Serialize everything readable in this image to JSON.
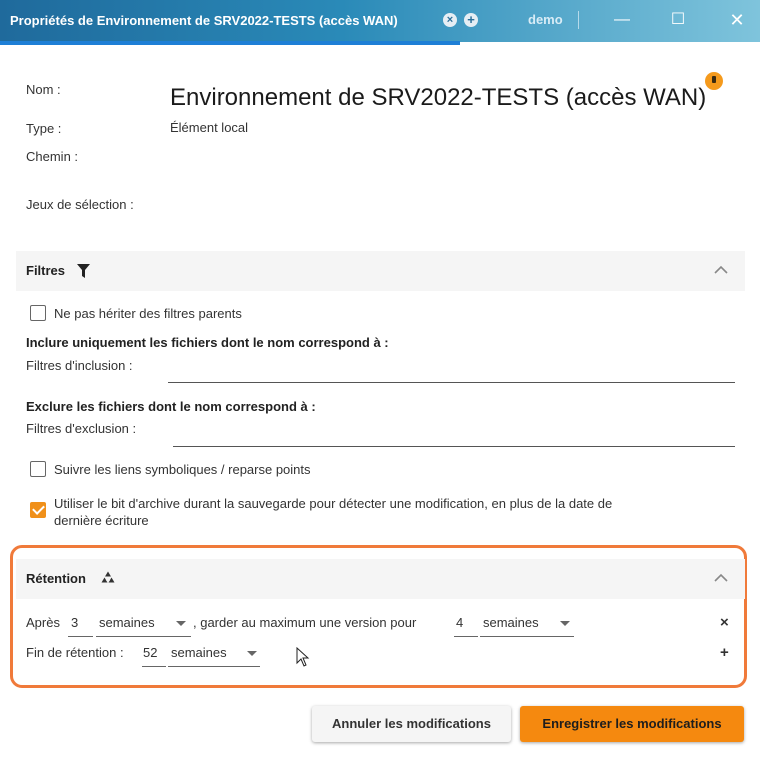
{
  "window": {
    "title": "Propriétés de Environnement de SRV2022-TESTS (accès WAN)",
    "user": "demo",
    "tab_close_glyph": "×",
    "tab_add_glyph": "+",
    "min_glyph": "—",
    "max_glyph": "☐",
    "close_glyph": "✕"
  },
  "info": {
    "nom_label": "Nom :",
    "nom_value": "Environnement de SRV2022-TESTS (accès WAN)",
    "type_label": "Type :",
    "type_value": "Élément local",
    "chemin_label": "Chemin :",
    "jeux_label": "Jeux de sélection :"
  },
  "filtres": {
    "title": "Filtres",
    "no_inherit_label": "Ne pas hériter des filtres parents",
    "no_inherit_checked": false,
    "include_heading": "Inclure uniquement les fichiers dont le nom correspond à :",
    "include_label": "Filtres d'inclusion :",
    "include_value": "",
    "exclude_heading": "Exclure les fichiers dont le nom correspond à :",
    "exclude_label": "Filtres d'exclusion :",
    "exclude_value": "",
    "symlinks_label": "Suivre les liens symboliques / reparse points",
    "symlinks_checked": false,
    "archive_bit_label_1": "Utiliser le bit d'archive durant la sauvegarde pour détecter une modification, en plus de la date de",
    "archive_bit_label_2": "dernière écriture",
    "archive_bit_checked": true
  },
  "retention": {
    "title": "Rétention",
    "after_label": "Après",
    "after_value": "3",
    "after_unit": "semaines",
    "keep_label": ", garder au maximum une version pour",
    "keep_value": "4",
    "keep_unit": "semaines",
    "end_label": "Fin de rétention :",
    "end_value": "52",
    "end_unit": "semaines",
    "remove_glyph": "×",
    "add_glyph": "+"
  },
  "actions": {
    "cancel_label": "Annuler les modifications",
    "save_label": "Enregistrer les modifications"
  },
  "colors": {
    "accent": "#f5890f",
    "highlight_border": "#f07a3a",
    "titlebar": "#1f6a9c",
    "tab_underline": "#1e7fd6"
  }
}
